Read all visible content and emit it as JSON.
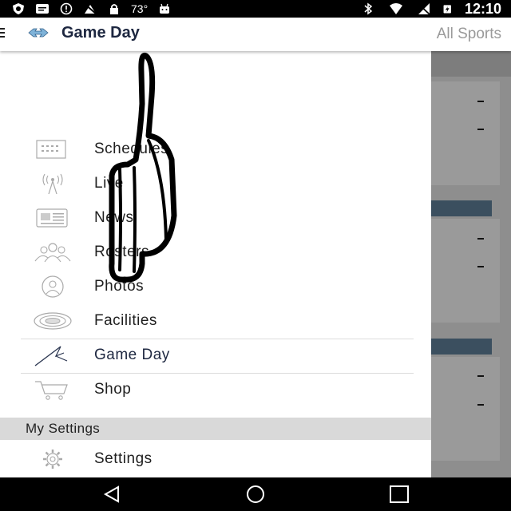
{
  "status_bar": {
    "temperature": "73°",
    "time": "12:10",
    "left_icons": [
      "shield-icon",
      "message-icon",
      "alert-icon",
      "no-signal-icon",
      "lock-icon",
      "android-icon"
    ],
    "right_icons": [
      "bluetooth-icon",
      "wifi-icon",
      "cell-signal-icon",
      "battery-charging-icon"
    ]
  },
  "app_bar": {
    "title": "Game Day",
    "action": "All Sports",
    "menu_icon": "hamburger-icon",
    "logo_icon": "nc-logo-icon"
  },
  "drawer": {
    "items": [
      {
        "label": "Schedules",
        "icon": "calendar-icon"
      },
      {
        "label": "Live",
        "icon": "broadcast-icon"
      },
      {
        "label": "News",
        "icon": "newspaper-icon"
      },
      {
        "label": "Rosters",
        "icon": "people-icon"
      },
      {
        "label": "Photos",
        "icon": "photo-icon"
      },
      {
        "label": "Facilities",
        "icon": "stadium-icon"
      },
      {
        "label": "Game Day",
        "icon": "flag-icon"
      },
      {
        "label": "Shop",
        "icon": "cart-icon"
      }
    ],
    "settings_header": "My Settings",
    "settings_item": {
      "label": "Settings",
      "icon": "gear-icon"
    }
  },
  "nav_bar": {
    "buttons": [
      "back-icon",
      "home-icon",
      "recents-icon"
    ]
  },
  "colors": {
    "title": "#1d2740",
    "strip": "#3b4f5f",
    "header_bg": "#d9d9d9"
  }
}
